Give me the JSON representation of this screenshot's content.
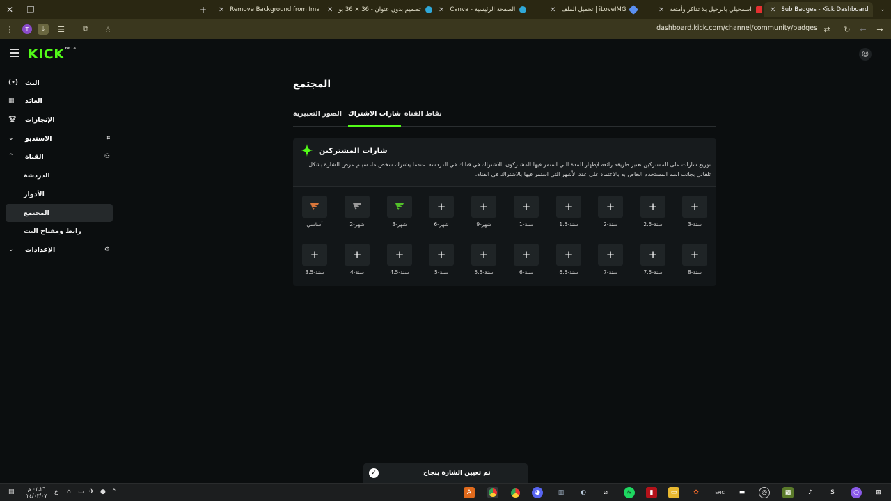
{
  "browser": {
    "tabs": [
      {
        "title": "Remove Background from Ima",
        "color": "#f2c230"
      },
      {
        "title": "تصميم بدون عنوان - 36 × 36 بو",
        "color": "#2fa8d8"
      },
      {
        "title": "Canva - الصفحة الرئيسية",
        "color": "#2fa8d8"
      },
      {
        "title": "تحميل الملف | iLoveIMG",
        "color": "#5a8ff0"
      },
      {
        "title": "اسمحيلي بالرحيل بلا تذاكر وأمتعة",
        "color": "#e43030"
      },
      {
        "title": "Sub Badges - Kick Dashboard",
        "color": "#53fc18"
      }
    ],
    "profile_letter": "T",
    "url": "dashboard.kick.com/channel/community/badges"
  },
  "app": {
    "logo": "KICK",
    "logo_tag": "BETA"
  },
  "sidebar": {
    "items": [
      {
        "label": "البث",
        "icon": "broadcast-icon"
      },
      {
        "label": "العائد",
        "icon": "revenue-icon"
      },
      {
        "label": "الإنجازات",
        "icon": "trophy-icon"
      },
      {
        "label": "الاستديو",
        "icon": "studio-icon"
      },
      {
        "label": "القناة",
        "icon": "channel-icon"
      }
    ],
    "channel_sub": [
      {
        "label": "الدردشة"
      },
      {
        "label": "الأدوار"
      },
      {
        "label": "المجتمع"
      },
      {
        "label": "رابط ومفتاح البث"
      }
    ],
    "settings": {
      "label": "الإعدادات",
      "icon": "gear-icon"
    }
  },
  "page": {
    "title": "المجتمع",
    "tabs": [
      "الصور التعبيرية",
      "شارات الاشتراك",
      "نقاط القناة"
    ],
    "active_tab": "شارات الاشتراك"
  },
  "card": {
    "title": "شارات المشتركين",
    "description": "توزيع شارات على المشتركين تعتبر طريقة رائعة لإظهار المدة التي استمر فيها المشتركون بالاشتراك في قناتك في الدردشة. عندما يشترك شخص ما، سيتم عرض الشارة بشكل تلقائي بجانب اسم المستخدم الخاص به بالاعتماد على عدد الأشهر التي استمر فيها بالاشتراك في القناة.",
    "accent": "#53fc18"
  },
  "badges_row1": [
    {
      "caption": "أساسي",
      "set": true,
      "color": "#d9763a"
    },
    {
      "caption": "شهر-2",
      "set": true,
      "color": "#9a9a9a"
    },
    {
      "caption": "شهر-3",
      "set": true,
      "color": "#53c22a"
    },
    {
      "caption": "شهر-6",
      "set": false
    },
    {
      "caption": "شهر-9",
      "set": false
    },
    {
      "caption": "سنة-1",
      "set": false
    },
    {
      "caption": "سنة-1.5",
      "set": false
    },
    {
      "caption": "سنة-2",
      "set": false
    },
    {
      "caption": "سنة-2.5",
      "set": false
    },
    {
      "caption": "سنة-3",
      "set": false
    }
  ],
  "badges_row2": [
    {
      "caption": "سنة-3.5"
    },
    {
      "caption": "سنة-4"
    },
    {
      "caption": "سنة-4.5"
    },
    {
      "caption": "سنة-5"
    },
    {
      "caption": "سنة-5.5"
    },
    {
      "caption": "سنة-6"
    },
    {
      "caption": "سنة-6.5"
    },
    {
      "caption": "سنة-7"
    },
    {
      "caption": "سنة-7.5"
    },
    {
      "caption": "سنة-8"
    }
  ],
  "plus_glyph": "+",
  "toast": {
    "message": "تم تعيين الشارة بنجاح"
  },
  "taskbar": {
    "time": "٠٢:٢٦ م",
    "date": "٢٤/٠٣/٠٧",
    "lang": "ع"
  }
}
